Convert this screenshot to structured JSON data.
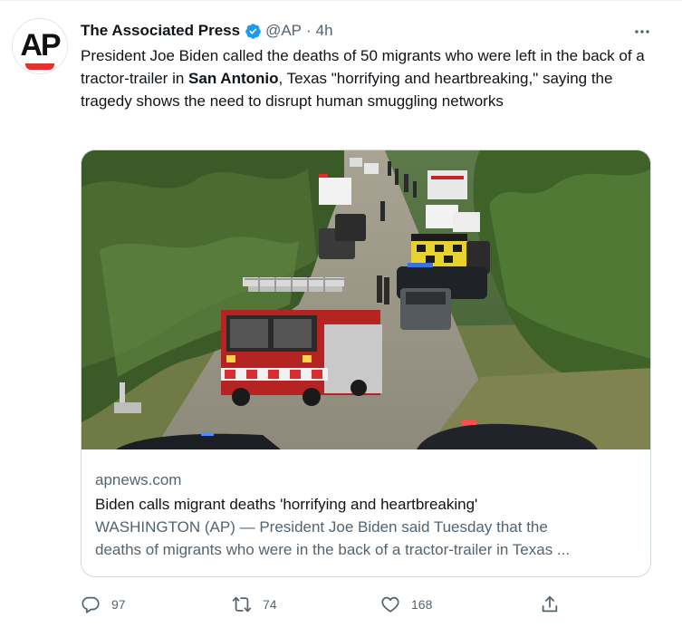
{
  "tweet": {
    "author_name": "The Associated Press",
    "handle": "@AP",
    "separator": "·",
    "time": "4h",
    "more_label": "···",
    "avatar_text": "AP",
    "text_before": "President Joe Biden called the deaths of 50 migrants who were left in the back of a tractor-trailer in ",
    "text_bold": "San Antonio",
    "text_after": ", Texas \"horrifying and heartbreaking,\" saying the tragedy shows the need to disrupt human smuggling networks"
  },
  "card": {
    "domain": "apnews.com",
    "title": "Biden calls migrant deaths 'horrifying and heartbreaking'",
    "desc_line1": "WASHINGTON (AP) — President Joe Biden said Tuesday that the",
    "desc_line2": "deaths of migrants who were in the back of a tractor-trailer in Texas ..."
  },
  "actions": {
    "replies": "97",
    "retweets": "74",
    "likes": "168"
  },
  "colors": {
    "verified": "#1d9bf0",
    "secondary_text": "#536471",
    "ap_red": "#e0342c"
  },
  "icons": [
    "verified-badge-icon",
    "more-icon",
    "reply-icon",
    "retweet-icon",
    "like-icon",
    "share-icon"
  ]
}
